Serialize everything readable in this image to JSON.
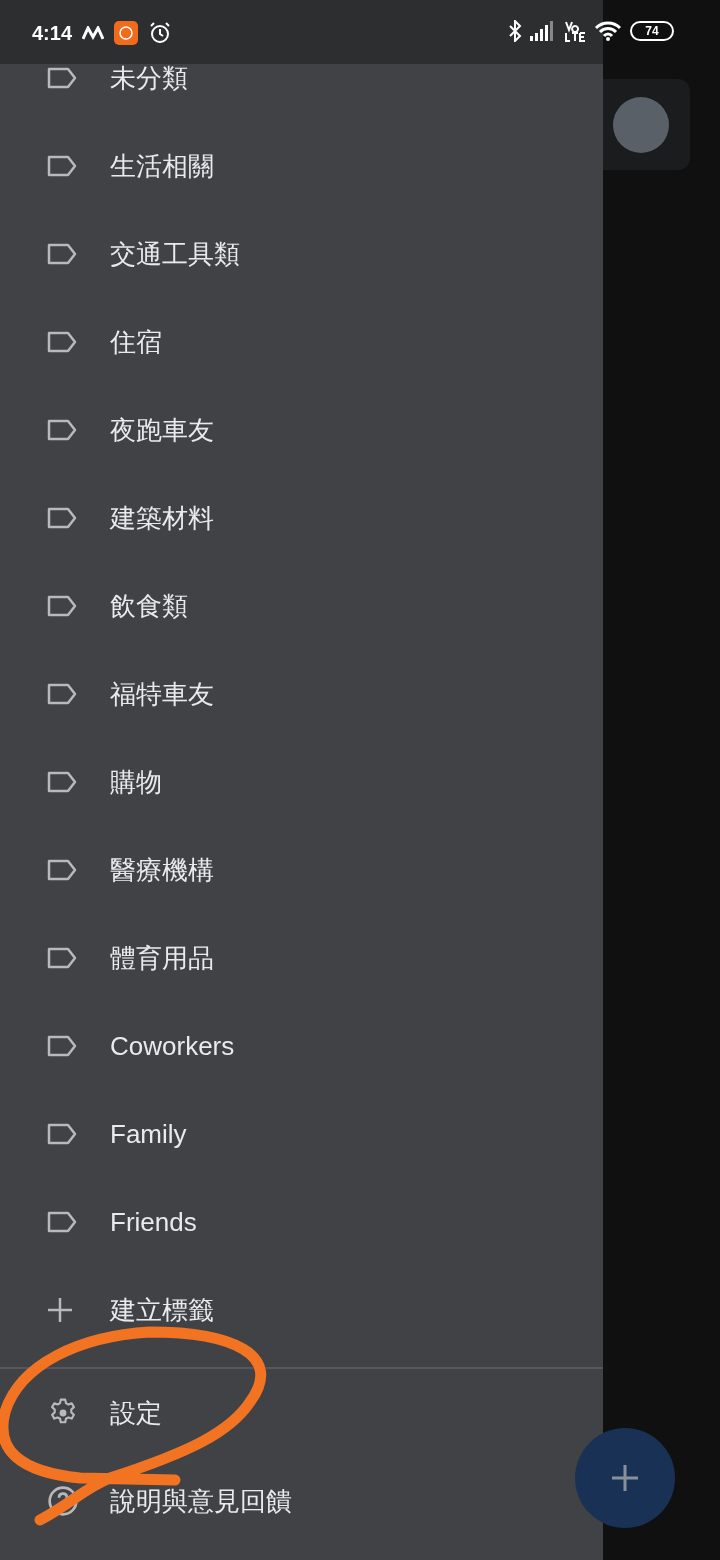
{
  "status_bar": {
    "time": "4:14",
    "battery": "74"
  },
  "drawer": {
    "labels": [
      {
        "kind": "label",
        "text": "未分類"
      },
      {
        "kind": "label",
        "text": "生活相關"
      },
      {
        "kind": "label",
        "text": "交通工具類"
      },
      {
        "kind": "label",
        "text": "住宿"
      },
      {
        "kind": "label",
        "text": "夜跑車友"
      },
      {
        "kind": "label",
        "text": "建築材料"
      },
      {
        "kind": "label",
        "text": "飲食類"
      },
      {
        "kind": "label",
        "text": "福特車友"
      },
      {
        "kind": "label",
        "text": "購物"
      },
      {
        "kind": "label",
        "text": "醫療機構"
      },
      {
        "kind": "label",
        "text": "體育用品"
      },
      {
        "kind": "label",
        "text": "Coworkers"
      },
      {
        "kind": "label",
        "text": "Family"
      },
      {
        "kind": "label",
        "text": "Friends"
      },
      {
        "kind": "create",
        "text": "建立標籤"
      }
    ],
    "footer": [
      {
        "kind": "settings",
        "text": "設定"
      },
      {
        "kind": "help",
        "text": "說明與意見回饋"
      }
    ]
  }
}
